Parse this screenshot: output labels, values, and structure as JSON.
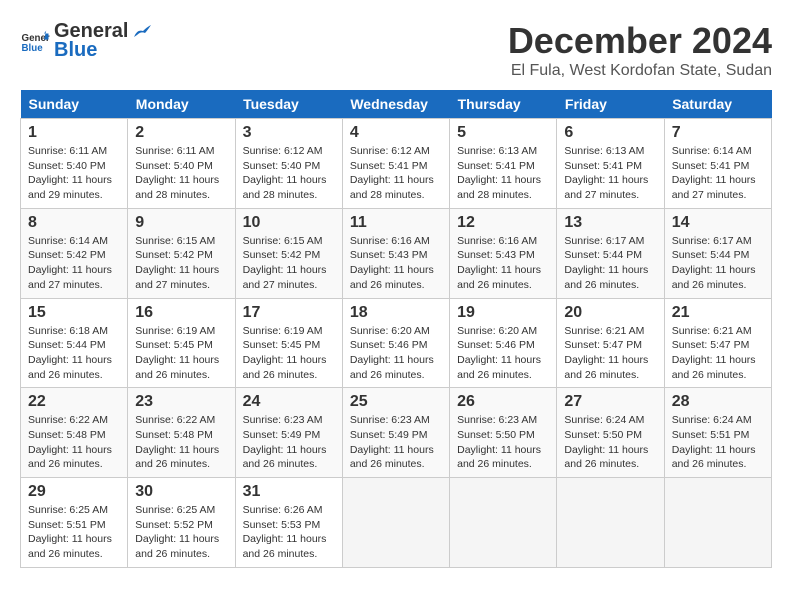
{
  "logo": {
    "general": "General",
    "blue": "Blue"
  },
  "header": {
    "month": "December 2024",
    "location": "El Fula, West Kordofan State, Sudan"
  },
  "days_of_week": [
    "Sunday",
    "Monday",
    "Tuesday",
    "Wednesday",
    "Thursday",
    "Friday",
    "Saturday"
  ],
  "weeks": [
    [
      {
        "day": "1",
        "sunrise": "6:11 AM",
        "sunset": "5:40 PM",
        "daylight": "11 hours and 29 minutes."
      },
      {
        "day": "2",
        "sunrise": "6:11 AM",
        "sunset": "5:40 PM",
        "daylight": "11 hours and 28 minutes."
      },
      {
        "day": "3",
        "sunrise": "6:12 AM",
        "sunset": "5:40 PM",
        "daylight": "11 hours and 28 minutes."
      },
      {
        "day": "4",
        "sunrise": "6:12 AM",
        "sunset": "5:41 PM",
        "daylight": "11 hours and 28 minutes."
      },
      {
        "day": "5",
        "sunrise": "6:13 AM",
        "sunset": "5:41 PM",
        "daylight": "11 hours and 28 minutes."
      },
      {
        "day": "6",
        "sunrise": "6:13 AM",
        "sunset": "5:41 PM",
        "daylight": "11 hours and 27 minutes."
      },
      {
        "day": "7",
        "sunrise": "6:14 AM",
        "sunset": "5:41 PM",
        "daylight": "11 hours and 27 minutes."
      }
    ],
    [
      {
        "day": "8",
        "sunrise": "6:14 AM",
        "sunset": "5:42 PM",
        "daylight": "11 hours and 27 minutes."
      },
      {
        "day": "9",
        "sunrise": "6:15 AM",
        "sunset": "5:42 PM",
        "daylight": "11 hours and 27 minutes."
      },
      {
        "day": "10",
        "sunrise": "6:15 AM",
        "sunset": "5:42 PM",
        "daylight": "11 hours and 27 minutes."
      },
      {
        "day": "11",
        "sunrise": "6:16 AM",
        "sunset": "5:43 PM",
        "daylight": "11 hours and 26 minutes."
      },
      {
        "day": "12",
        "sunrise": "6:16 AM",
        "sunset": "5:43 PM",
        "daylight": "11 hours and 26 minutes."
      },
      {
        "day": "13",
        "sunrise": "6:17 AM",
        "sunset": "5:44 PM",
        "daylight": "11 hours and 26 minutes."
      },
      {
        "day": "14",
        "sunrise": "6:17 AM",
        "sunset": "5:44 PM",
        "daylight": "11 hours and 26 minutes."
      }
    ],
    [
      {
        "day": "15",
        "sunrise": "6:18 AM",
        "sunset": "5:44 PM",
        "daylight": "11 hours and 26 minutes."
      },
      {
        "day": "16",
        "sunrise": "6:19 AM",
        "sunset": "5:45 PM",
        "daylight": "11 hours and 26 minutes."
      },
      {
        "day": "17",
        "sunrise": "6:19 AM",
        "sunset": "5:45 PM",
        "daylight": "11 hours and 26 minutes."
      },
      {
        "day": "18",
        "sunrise": "6:20 AM",
        "sunset": "5:46 PM",
        "daylight": "11 hours and 26 minutes."
      },
      {
        "day": "19",
        "sunrise": "6:20 AM",
        "sunset": "5:46 PM",
        "daylight": "11 hours and 26 minutes."
      },
      {
        "day": "20",
        "sunrise": "6:21 AM",
        "sunset": "5:47 PM",
        "daylight": "11 hours and 26 minutes."
      },
      {
        "day": "21",
        "sunrise": "6:21 AM",
        "sunset": "5:47 PM",
        "daylight": "11 hours and 26 minutes."
      }
    ],
    [
      {
        "day": "22",
        "sunrise": "6:22 AM",
        "sunset": "5:48 PM",
        "daylight": "11 hours and 26 minutes."
      },
      {
        "day": "23",
        "sunrise": "6:22 AM",
        "sunset": "5:48 PM",
        "daylight": "11 hours and 26 minutes."
      },
      {
        "day": "24",
        "sunrise": "6:23 AM",
        "sunset": "5:49 PM",
        "daylight": "11 hours and 26 minutes."
      },
      {
        "day": "25",
        "sunrise": "6:23 AM",
        "sunset": "5:49 PM",
        "daylight": "11 hours and 26 minutes."
      },
      {
        "day": "26",
        "sunrise": "6:23 AM",
        "sunset": "5:50 PM",
        "daylight": "11 hours and 26 minutes."
      },
      {
        "day": "27",
        "sunrise": "6:24 AM",
        "sunset": "5:50 PM",
        "daylight": "11 hours and 26 minutes."
      },
      {
        "day": "28",
        "sunrise": "6:24 AM",
        "sunset": "5:51 PM",
        "daylight": "11 hours and 26 minutes."
      }
    ],
    [
      {
        "day": "29",
        "sunrise": "6:25 AM",
        "sunset": "5:51 PM",
        "daylight": "11 hours and 26 minutes."
      },
      {
        "day": "30",
        "sunrise": "6:25 AM",
        "sunset": "5:52 PM",
        "daylight": "11 hours and 26 minutes."
      },
      {
        "day": "31",
        "sunrise": "6:26 AM",
        "sunset": "5:53 PM",
        "daylight": "11 hours and 26 minutes."
      },
      null,
      null,
      null,
      null
    ]
  ]
}
